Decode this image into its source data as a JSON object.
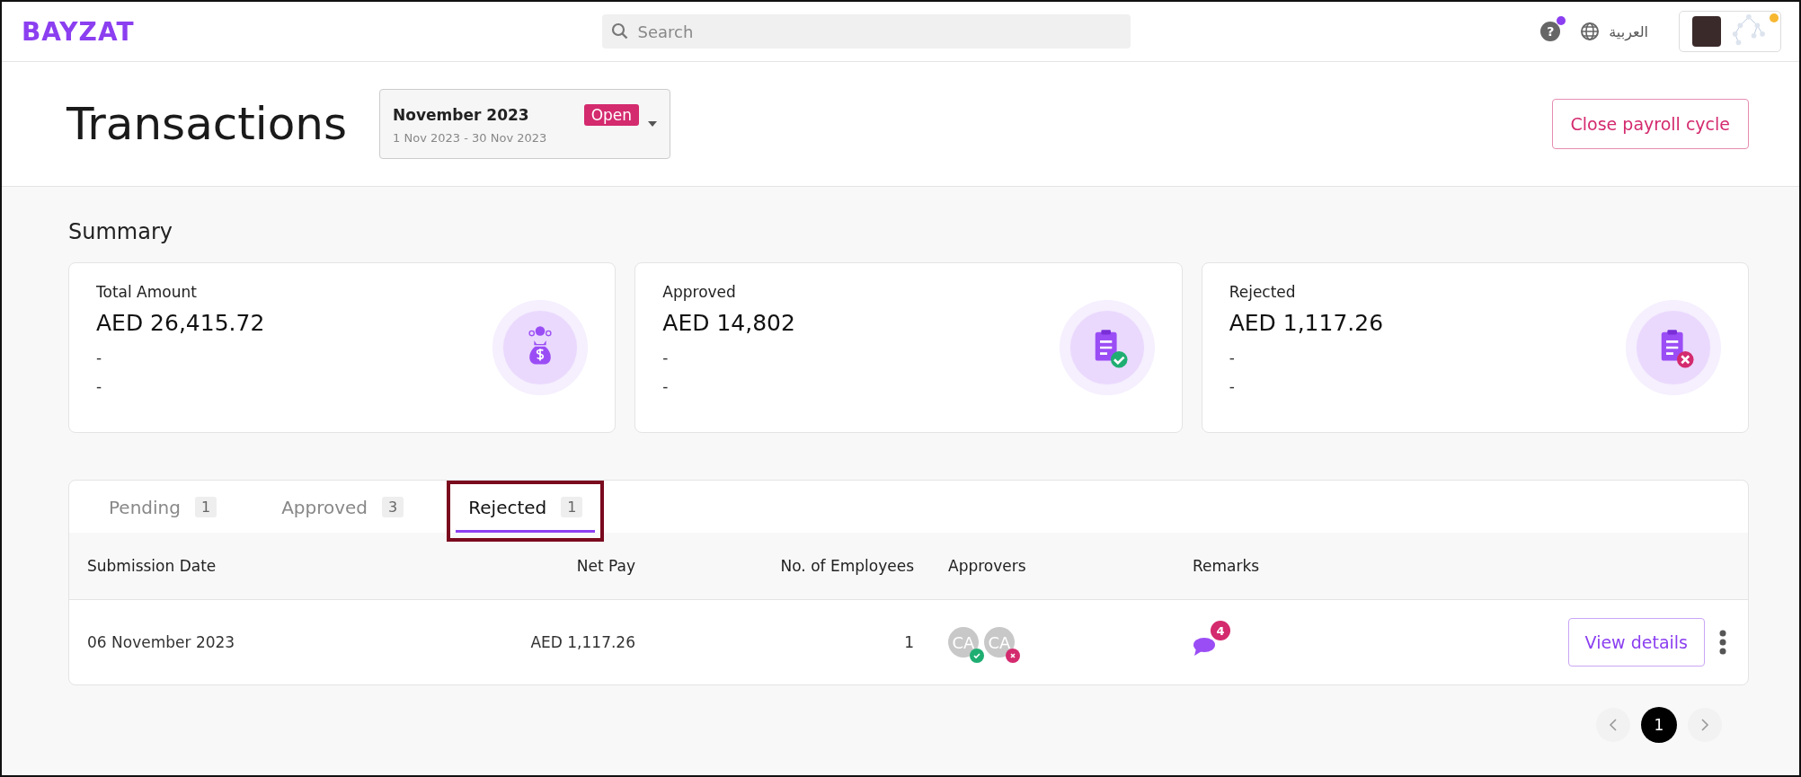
{
  "header": {
    "logo": "BAYZAT",
    "search": {
      "placeholder": "Search"
    },
    "help_label": "?",
    "help_notification": true,
    "language": "العربية",
    "profile_notification": true
  },
  "page": {
    "title": "Transactions",
    "period": {
      "name": "November 2023",
      "status": "Open",
      "range": "1 Nov 2023 - 30 Nov 2023"
    },
    "close_button": "Close payroll cycle"
  },
  "summary": {
    "title": "Summary",
    "cards": [
      {
        "label": "Total Amount",
        "amount": "AED 26,415.72",
        "lines": [
          "-",
          "-"
        ],
        "kind": "money"
      },
      {
        "label": "Approved",
        "amount": "AED 14,802",
        "lines": [
          "-",
          "-"
        ],
        "kind": "approved"
      },
      {
        "label": "Rejected",
        "amount": "AED 1,117.26",
        "lines": [
          "-",
          "-"
        ],
        "kind": "rejected"
      }
    ]
  },
  "tabs": [
    {
      "label": "Pending",
      "count": "1",
      "selected": false,
      "highlighted": false
    },
    {
      "label": "Approved",
      "count": "3",
      "selected": false,
      "highlighted": false
    },
    {
      "label": "Rejected",
      "count": "1",
      "selected": true,
      "highlighted": true
    }
  ],
  "table": {
    "columns": [
      "Submission Date",
      "Net Pay",
      "No. of Employees",
      "Approvers",
      "Remarks"
    ],
    "rows": [
      {
        "date": "06 November 2023",
        "net_pay": "AED 1,117.26",
        "employees": "1",
        "approvers": [
          {
            "initials": "CA",
            "kind": "approved"
          },
          {
            "initials": "CA",
            "kind": "rejected"
          }
        ],
        "remarks_count": "4",
        "action": "View details"
      }
    ]
  },
  "pagination": {
    "pages": [
      {
        "label": "1",
        "selected": true
      }
    ]
  }
}
